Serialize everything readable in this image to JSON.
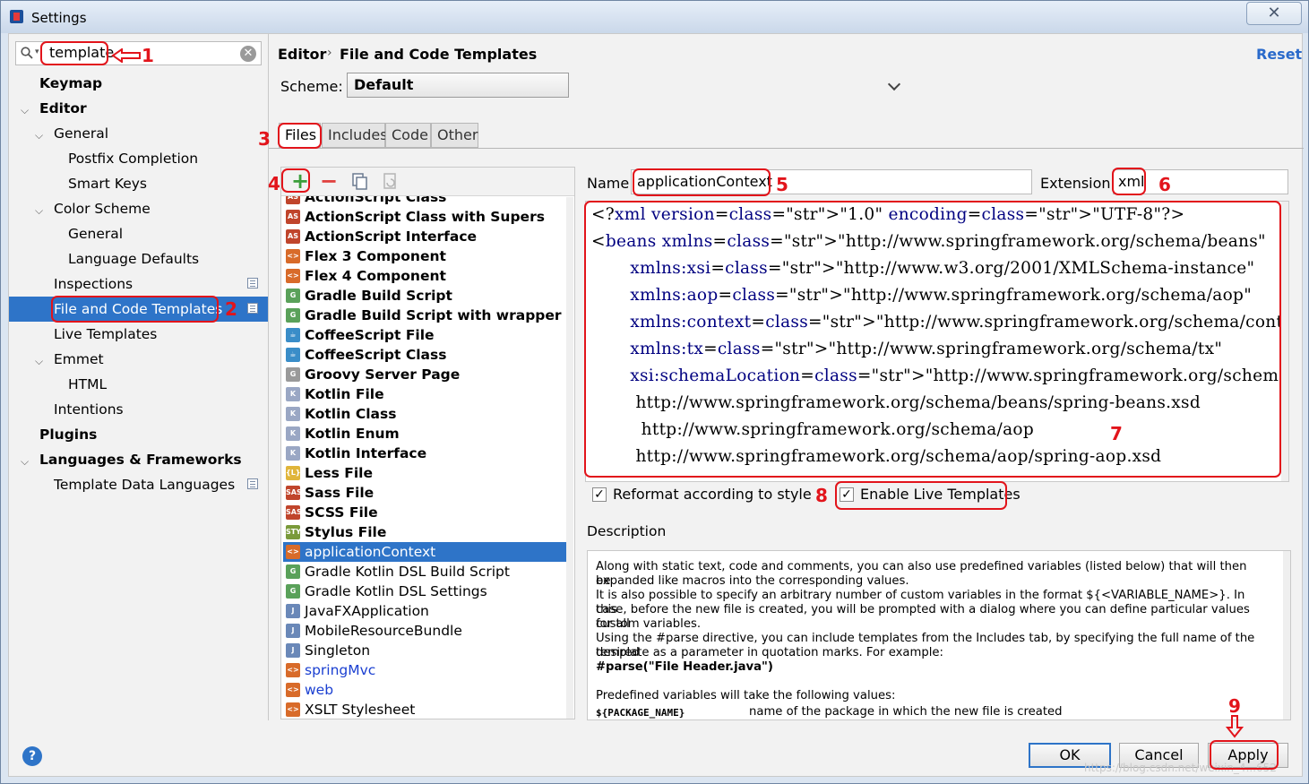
{
  "window": {
    "title": "Settings",
    "close_glyph": "✕"
  },
  "search": {
    "value": "template",
    "clear_glyph": "✕"
  },
  "sidebar": {
    "items": [
      {
        "label": "Keymap"
      },
      {
        "label": "Editor"
      },
      {
        "label": "General"
      },
      {
        "label": "Postfix Completion"
      },
      {
        "label": "Smart Keys"
      },
      {
        "label": "Color Scheme"
      },
      {
        "label": "General"
      },
      {
        "label": "Language Defaults"
      },
      {
        "label": "Inspections"
      },
      {
        "label": "File and Code Templates"
      },
      {
        "label": "Live Templates"
      },
      {
        "label": "Emmet"
      },
      {
        "label": "HTML"
      },
      {
        "label": "Intentions"
      },
      {
        "label": "Plugins"
      },
      {
        "label": "Languages & Frameworks"
      },
      {
        "label": "Template Data Languages"
      }
    ]
  },
  "header": {
    "breadcrumb_1": "Editor",
    "breadcrumb_sep": "›",
    "breadcrumb_2": "File and Code Templates",
    "reset": "Reset"
  },
  "scheme": {
    "label": "Scheme:",
    "value": "Default"
  },
  "tabs": [
    {
      "label": "Files"
    },
    {
      "label": "Includes"
    },
    {
      "label": "Code"
    },
    {
      "label": "Other"
    }
  ],
  "toolbar": {
    "add": "+",
    "remove": "−"
  },
  "files": [
    {
      "name": "ActionScript Class",
      "icon": "AS",
      "color": "#c0452c",
      "bold": true
    },
    {
      "name": "ActionScript Class with Supers",
      "icon": "AS",
      "color": "#c0452c",
      "bold": true
    },
    {
      "name": "ActionScript Interface",
      "icon": "AS",
      "color": "#c0452c",
      "bold": true
    },
    {
      "name": "Flex 3 Component",
      "icon": "<>",
      "color": "#d86b2a",
      "bold": true
    },
    {
      "name": "Flex 4 Component",
      "icon": "<>",
      "color": "#d86b2a",
      "bold": true
    },
    {
      "name": "Gradle Build Script",
      "icon": "G",
      "color": "#5aa15a",
      "bold": true
    },
    {
      "name": "Gradle Build Script with wrapper",
      "icon": "G",
      "color": "#5aa15a",
      "bold": true
    },
    {
      "name": "CoffeeScript File",
      "icon": "☕",
      "color": "#3a8dc8",
      "bold": true
    },
    {
      "name": "CoffeeScript Class",
      "icon": "☕",
      "color": "#3a8dc8",
      "bold": true
    },
    {
      "name": "Groovy Server Page",
      "icon": "G",
      "color": "#9a9a9a",
      "bold": true
    },
    {
      "name": "Kotlin File",
      "icon": "K",
      "color": "#9aa7c4",
      "bold": true
    },
    {
      "name": "Kotlin Class",
      "icon": "K",
      "color": "#9aa7c4",
      "bold": true
    },
    {
      "name": "Kotlin Enum",
      "icon": "K",
      "color": "#9aa7c4",
      "bold": true
    },
    {
      "name": "Kotlin Interface",
      "icon": "K",
      "color": "#9aa7c4",
      "bold": true
    },
    {
      "name": "Less File",
      "icon": "{L}",
      "color": "#e0b53a",
      "bold": true
    },
    {
      "name": "Sass File",
      "icon": "SASS",
      "color": "#c0452c",
      "bold": true
    },
    {
      "name": "SCSS File",
      "icon": "SASS",
      "color": "#c0452c",
      "bold": true
    },
    {
      "name": "Stylus File",
      "icon": "STYL",
      "color": "#7a9a3a",
      "bold": true
    },
    {
      "name": "applicationContext",
      "icon": "<>",
      "color": "#d86b2a",
      "bold": false,
      "selected": true
    },
    {
      "name": "Gradle Kotlin DSL Build Script",
      "icon": "G",
      "color": "#5aa15a",
      "bold": false
    },
    {
      "name": "Gradle Kotlin DSL Settings",
      "icon": "G",
      "color": "#5aa15a",
      "bold": false
    },
    {
      "name": "JavaFXApplication",
      "icon": "J",
      "color": "#6a88b8",
      "bold": false
    },
    {
      "name": "MobileResourceBundle",
      "icon": "J",
      "color": "#6a88b8",
      "bold": false
    },
    {
      "name": "Singleton",
      "icon": "J",
      "color": "#6a88b8",
      "bold": false
    },
    {
      "name": "springMvc",
      "icon": "<>",
      "color": "#d86b2a",
      "bold": false,
      "blue": true
    },
    {
      "name": "web",
      "icon": "<>",
      "color": "#d86b2a",
      "bold": false,
      "blue": true
    },
    {
      "name": "XSLT Stylesheet",
      "icon": "<>",
      "color": "#d86b2a",
      "bold": false
    }
  ],
  "template": {
    "name_label": "Name:",
    "name_value": "applicationContext",
    "ext_label": "Extension:",
    "ext_value": "xml"
  },
  "code_lines": [
    "<?xml version=\"1.0\" encoding=\"UTF-8\"?>",
    "<beans xmlns=\"http://www.springframework.org/schema/beans\"",
    "       xmlns:xsi=\"http://www.w3.org/2001/XMLSchema-instance\"",
    "       xmlns:aop=\"http://www.springframework.org/schema/aop\"",
    "       xmlns:context=\"http://www.springframework.org/schema/context\"",
    "       xmlns:tx=\"http://www.springframework.org/schema/tx\"",
    "       xsi:schemaLocation=\"http://www.springframework.org/schema/beans",
    "        http://www.springframework.org/schema/beans/spring-beans.xsd",
    "         http://www.springframework.org/schema/aop",
    "        http://www.springframework.org/schema/aop/spring-aop.xsd"
  ],
  "options": {
    "reformat": "Reformat according to style",
    "live": "Enable Live Templates",
    "check_glyph": "✓"
  },
  "description": {
    "label": "Description",
    "lines": [
      "Along with static text, code and comments, you can also use predefined variables (listed below) that will then be",
      "expanded like macros into the corresponding values.",
      "It is also possible to specify an arbitrary number of custom variables in the format ${<VARIABLE_NAME>}. In this",
      "case, before the new file is created, you will be prompted with a dialog where you can define particular values for all",
      "custom variables.",
      "Using the #parse directive, you can include templates from the Includes tab, by specifying the full name of the desired",
      "template as a parameter in quotation marks. For example:",
      "#parse(\"File Header.java\")",
      "",
      "Predefined variables will take the following values:"
    ],
    "var_name": "${PACKAGE_NAME}",
    "var_desc": "name of the package in which the new file is created"
  },
  "buttons": {
    "ok": "OK",
    "cancel": "Cancel",
    "apply": "Apply",
    "help": "?"
  },
  "annotations": [
    "1",
    "2",
    "3",
    "4",
    "5",
    "6",
    "7",
    "8",
    "9"
  ],
  "watermark": "https://blog.csdn.net/weixin_4...652"
}
